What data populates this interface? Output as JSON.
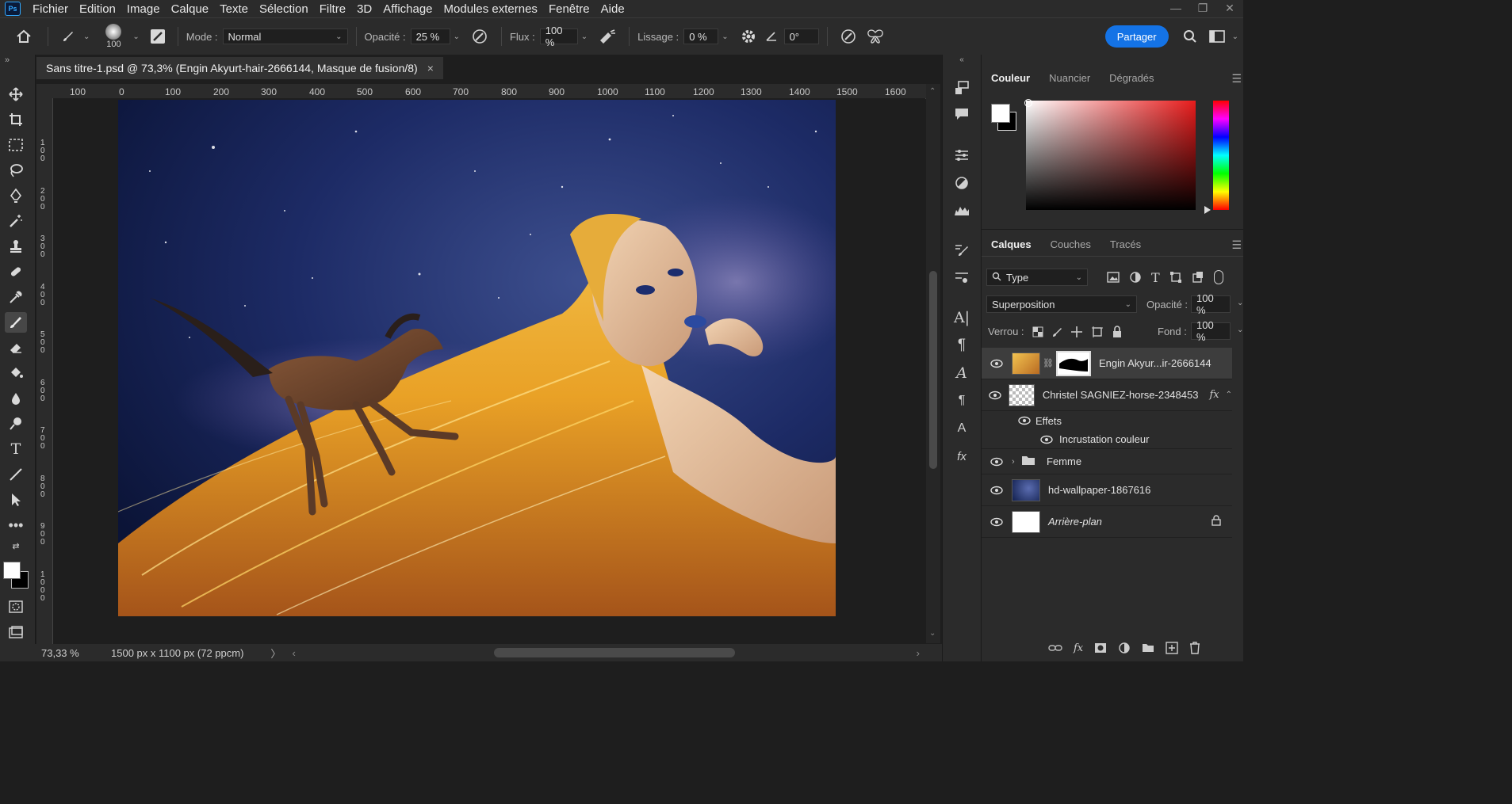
{
  "app": {
    "logo_text": "Ps",
    "menu": [
      "Fichier",
      "Edition",
      "Image",
      "Calque",
      "Texte",
      "Sélection",
      "Filtre",
      "3D",
      "Affichage",
      "Modules externes",
      "Fenêtre",
      "Aide"
    ]
  },
  "window_controls": [
    "—",
    "❐",
    "✕"
  ],
  "options": {
    "brush_size": "100",
    "mode_label": "Mode :",
    "mode_value": "Normal",
    "opacity_label": "Opacité :",
    "opacity_value": "25 %",
    "flow_label": "Flux :",
    "flow_value": "100 %",
    "smoothing_label": "Lissage :",
    "smoothing_value": "0 %",
    "angle_value": "0°",
    "share_label": "Partager"
  },
  "document": {
    "tab_title": "Sans titre-1.psd @ 73,3% (Engin Akyurt-hair-2666144, Masque de fusion/8)",
    "close_glyph": "×",
    "ruler_h": [
      "100",
      "0",
      "100",
      "200",
      "300",
      "400",
      "500",
      "600",
      "700",
      "800",
      "900",
      "1000",
      "1100",
      "1200",
      "1300",
      "1400",
      "1500",
      "1600"
    ],
    "ruler_v": [
      "1 0 0",
      "2 0 0",
      "3 0 0",
      "4 0 0",
      "5 0 0",
      "6 0 0",
      "7 0 0",
      "8 0 0",
      "9 0 0",
      "1 0 0 0"
    ]
  },
  "status": {
    "zoom": "73,33 %",
    "doc_size": "1500 px x 1100 px (72 ppcm)",
    "arrow": "〉",
    "scroll_left": "‹",
    "scroll_right": "›"
  },
  "color_panel": {
    "tabs": [
      "Couleur",
      "Nuancier",
      "Dégradés"
    ],
    "active_tab": "Couleur",
    "hue": "#e81c1c"
  },
  "layers_panel": {
    "tabs": [
      "Calques",
      "Couches",
      "Tracés"
    ],
    "active_tab": "Calques",
    "filter_value": "Type",
    "blend_mode": "Superposition",
    "opacity_label": "Opacité :",
    "opacity_value": "100 %",
    "lock_label": "Verrou :",
    "fill_label": "Fond :",
    "fill_value": "100 %",
    "layers": [
      {
        "name": "Engin Akyur...ir-2666144",
        "selected": true,
        "has_mask": true
      },
      {
        "name": "Christel SAGNIEZ-horse-2348453",
        "fx": "fx"
      },
      {
        "name": "Effets"
      },
      {
        "name": "Incrustation couleur"
      },
      {
        "name": "Femme",
        "group": true
      },
      {
        "name": "hd-wallpaper-1867616"
      },
      {
        "name": "Arrière-plan",
        "italic": true,
        "locked": true
      }
    ]
  },
  "colors": {
    "accent": "#1473e6",
    "panel": "#2b2b2b",
    "selected_row": "#3d3d3d"
  }
}
